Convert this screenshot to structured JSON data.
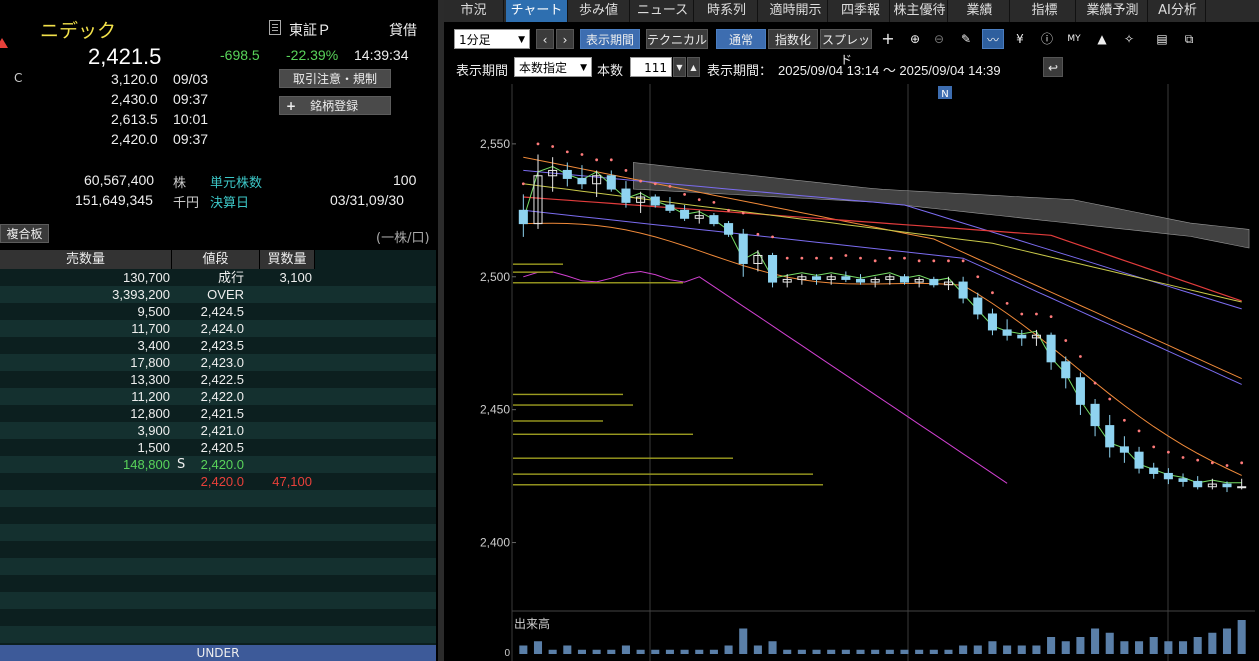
{
  "stock": {
    "name": "ニデック",
    "market": "東証Ｐ",
    "margin": "貸借",
    "price": "2,421.5",
    "change": "-698.5",
    "change_pct": "-22.39%",
    "time": "14:39:34",
    "c_label": "C",
    "alert_icon": "triangle-alert-icon"
  },
  "quote": [
    {
      "value": "3,120.0",
      "time": "09/03"
    },
    {
      "value": "2,430.0",
      "time": "09:37"
    },
    {
      "value": "2,613.5",
      "time": "10:01"
    },
    {
      "value": "2,420.0",
      "time": "09:37"
    }
  ],
  "buttons": {
    "caution": "取引注意・規制",
    "register": "銘柄登録",
    "register_plus": "+"
  },
  "volume_info": {
    "volume": "60,567,400",
    "volume_unit": "株",
    "turnover": "151,649,345",
    "turnover_unit": "千円",
    "unit_shares_label": "単元株数",
    "unit_shares": "100",
    "settlement_label": "決算日",
    "settlement": "03/31,09/30"
  },
  "book": {
    "tab_label": "複合板",
    "per_share": "(一株/口)",
    "headers": [
      "売数量",
      "値段",
      "買数量"
    ],
    "rows": [
      {
        "sell": "130,700",
        "price": "成行",
        "buy": "3,100"
      },
      {
        "sell": "3,393,200",
        "price": "OVER",
        "buy": ""
      },
      {
        "sell": "9,500",
        "price": "2,424.5",
        "buy": ""
      },
      {
        "sell": "11,700",
        "price": "2,424.0",
        "buy": ""
      },
      {
        "sell": "3,400",
        "price": "2,423.5",
        "buy": ""
      },
      {
        "sell": "17,800",
        "price": "2,423.0",
        "buy": ""
      },
      {
        "sell": "13,300",
        "price": "2,422.5",
        "buy": ""
      },
      {
        "sell": "11,200",
        "price": "2,422.0",
        "buy": ""
      },
      {
        "sell": "12,800",
        "price": "2,421.5",
        "buy": ""
      },
      {
        "sell": "3,900",
        "price": "2,421.0",
        "buy": ""
      },
      {
        "sell": "1,500",
        "price": "2,420.5",
        "buy": ""
      },
      {
        "sell": "148,800",
        "price": "2,420.0",
        "buy": "",
        "marker": "S",
        "sell_color": "#59d35a",
        "price_color": "#59d35a"
      },
      {
        "sell": "",
        "price": "2,420.0",
        "buy": "47,100",
        "price_color": "#e8403a",
        "buy_color": "#e8403a"
      }
    ],
    "under": "UNDER"
  },
  "tabs": [
    "市況",
    "チャート",
    "歩み値",
    "ニュース",
    "時系列",
    "適時開示",
    "四季報",
    "株主優待",
    "業績",
    "指標",
    "業績予測",
    "AI分析"
  ],
  "active_tab": 1,
  "toolbar": {
    "interval": "1分足",
    "display_period": "表示期間",
    "technical": "テクニカル",
    "normal": "通常",
    "indexed": "指数化",
    "spread": "スプレッド",
    "period_label": "表示期間",
    "count_mode": "本数指定",
    "count_label": "本数",
    "count_value": "111",
    "period_range_label": "表示期間：",
    "period_range": "2025/09/04 13:14 ～ 2025/09/04 14:39",
    "icons": [
      "plus-icon",
      "zoom-in-icon",
      "zoom-out-icon",
      "pencil-icon",
      "indicator-icon",
      "yen-icon",
      "info-icon",
      "my-icon",
      "area-chart-icon",
      "wrench-icon",
      "print-icon",
      "popout-icon"
    ]
  },
  "chart_data": {
    "type": "candlestick",
    "y_ticks": [
      "2,550",
      "2,500",
      "2,450",
      "2,400"
    ],
    "ylim": [
      2375,
      2565
    ],
    "news_marker": "N",
    "volume_label": "出来高",
    "volume_zero": "0",
    "colors": {
      "up": "#e8e8e8",
      "down": "#8fd3f0",
      "psar": "#ff7b7b",
      "bb": "#f08a3a",
      "bb2": "#7b6cf0",
      "ma": "#e23c3c",
      "cloud": "#777777",
      "magenta": "#d040d0",
      "vol": "#5a7fa8",
      "vbp": "#9c9c20"
    },
    "candles": [
      [
        2525,
        2531,
        2515,
        2520
      ],
      [
        2520,
        2546,
        2518,
        2538
      ],
      [
        2538,
        2545,
        2532,
        2540
      ],
      [
        2540,
        2543,
        2534,
        2537
      ],
      [
        2537,
        2542,
        2533,
        2535
      ],
      [
        2535,
        2540,
        2530,
        2538
      ],
      [
        2538,
        2540,
        2532,
        2533
      ],
      [
        2533,
        2536,
        2526,
        2528
      ],
      [
        2528,
        2532,
        2524,
        2530
      ],
      [
        2530,
        2531,
        2526,
        2527
      ],
      [
        2527,
        2530,
        2524,
        2525
      ],
      [
        2525,
        2527,
        2521,
        2522
      ],
      [
        2522,
        2525,
        2520,
        2523
      ],
      [
        2523,
        2524,
        2519,
        2520
      ],
      [
        2520,
        2521,
        2515,
        2516
      ],
      [
        2516,
        2518,
        2500,
        2505
      ],
      [
        2505,
        2510,
        2502,
        2508
      ],
      [
        2508,
        2509,
        2496,
        2498
      ],
      [
        2498,
        2501,
        2496,
        2499
      ],
      [
        2499,
        2501,
        2497,
        2500
      ],
      [
        2500,
        2501,
        2497,
        2499
      ],
      [
        2499,
        2501,
        2497,
        2500
      ],
      [
        2500,
        2502,
        2498,
        2499
      ],
      [
        2499,
        2501,
        2497,
        2498
      ],
      [
        2498,
        2500,
        2496,
        2499
      ],
      [
        2499,
        2501,
        2497,
        2500
      ],
      [
        2500,
        2501,
        2497,
        2498
      ],
      [
        2498,
        2500,
        2496,
        2499
      ],
      [
        2499,
        2500,
        2496,
        2497
      ],
      [
        2497,
        2500,
        2495,
        2498
      ],
      [
        2498,
        2500,
        2490,
        2492
      ],
      [
        2492,
        2494,
        2484,
        2486
      ],
      [
        2486,
        2488,
        2478,
        2480
      ],
      [
        2480,
        2484,
        2476,
        2478
      ],
      [
        2478,
        2480,
        2474,
        2477
      ],
      [
        2477,
        2480,
        2474,
        2478
      ],
      [
        2478,
        2479,
        2465,
        2468
      ],
      [
        2468,
        2470,
        2458,
        2462
      ],
      [
        2462,
        2464,
        2448,
        2452
      ],
      [
        2452,
        2454,
        2440,
        2444
      ],
      [
        2444,
        2448,
        2432,
        2436
      ],
      [
        2436,
        2440,
        2430,
        2434
      ],
      [
        2434,
        2436,
        2426,
        2428
      ],
      [
        2428,
        2430,
        2424,
        2426
      ],
      [
        2426,
        2428,
        2422,
        2424
      ],
      [
        2424,
        2426,
        2421,
        2423
      ],
      [
        2423,
        2425,
        2420,
        2421
      ],
      [
        2421,
        2424,
        2420,
        2422
      ],
      [
        2422,
        2423,
        2419,
        2421
      ],
      [
        2421,
        2424,
        2420,
        2421
      ]
    ],
    "volume": [
      2,
      3,
      1,
      2,
      1,
      1,
      1,
      2,
      1,
      1,
      1,
      1,
      1,
      1,
      2,
      6,
      2,
      3,
      1,
      1,
      1,
      1,
      1,
      1,
      1,
      1,
      1,
      1,
      1,
      1,
      2,
      2,
      3,
      2,
      2,
      2,
      4,
      3,
      4,
      6,
      5,
      3,
      3,
      4,
      3,
      3,
      4,
      5,
      6,
      8
    ]
  }
}
